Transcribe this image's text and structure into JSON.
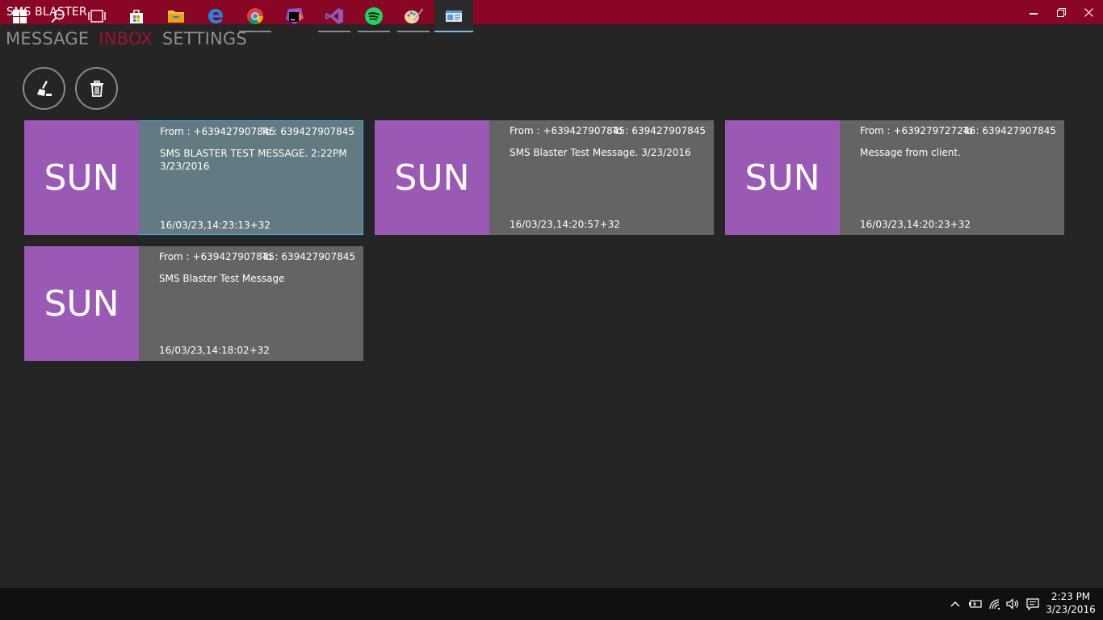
{
  "window": {
    "title": "SMS BLASTER"
  },
  "nav": {
    "tabs": [
      "MESSAGE",
      "INBOX",
      "SETTINGS"
    ],
    "active": "INBOX"
  },
  "toolbar": {
    "clear_icon": "broom-icon",
    "delete_icon": "trash-icon"
  },
  "messages": [
    {
      "carrier": "SUN",
      "from": "From : +639427907845",
      "to": "To : 639427907845",
      "body": "SMS BLASTER TEST MESSAGE. 2:22PM 3/23/2016",
      "time": "16/03/23,14:23:13+32",
      "selected": true
    },
    {
      "carrier": "SUN",
      "from": "From : +639427907845",
      "to": "To : 639427907845",
      "body": "SMS Blaster Test Message. 3/23/2016",
      "time": "16/03/23,14:20:57+32"
    },
    {
      "carrier": "SUN",
      "from": "From : +639279727246",
      "to": "To : 639427907845",
      "body": "Message from client.",
      "time": "16/03/23,14:20:23+32"
    },
    {
      "carrier": "SUN",
      "from": "From : +639427907845",
      "to": "To : 639427907845",
      "body": "SMS Blaster Test Message",
      "time": "16/03/23,14:18:02+32"
    }
  ],
  "colors": {
    "titlebar": "#890724",
    "accent": "#a3102a",
    "avatar": "#9b59b6",
    "card": "#646464",
    "card_selected": "#647a83"
  },
  "taskbar": {
    "items": [
      "windows-start-icon",
      "search-icon",
      "task-view-icon",
      "store-icon",
      "file-explorer-icon",
      "edge-icon",
      "chrome-icon",
      "phpstorm-icon",
      "visual-studio-icon",
      "spotify-icon",
      "paint-icon",
      "sms-blaster-app-icon"
    ],
    "tray": [
      "chevron-up-icon",
      "battery-icon",
      "wifi-icon",
      "volume-icon",
      "notification-icon"
    ],
    "time": "2:23 PM",
    "date": "3/23/2016"
  }
}
